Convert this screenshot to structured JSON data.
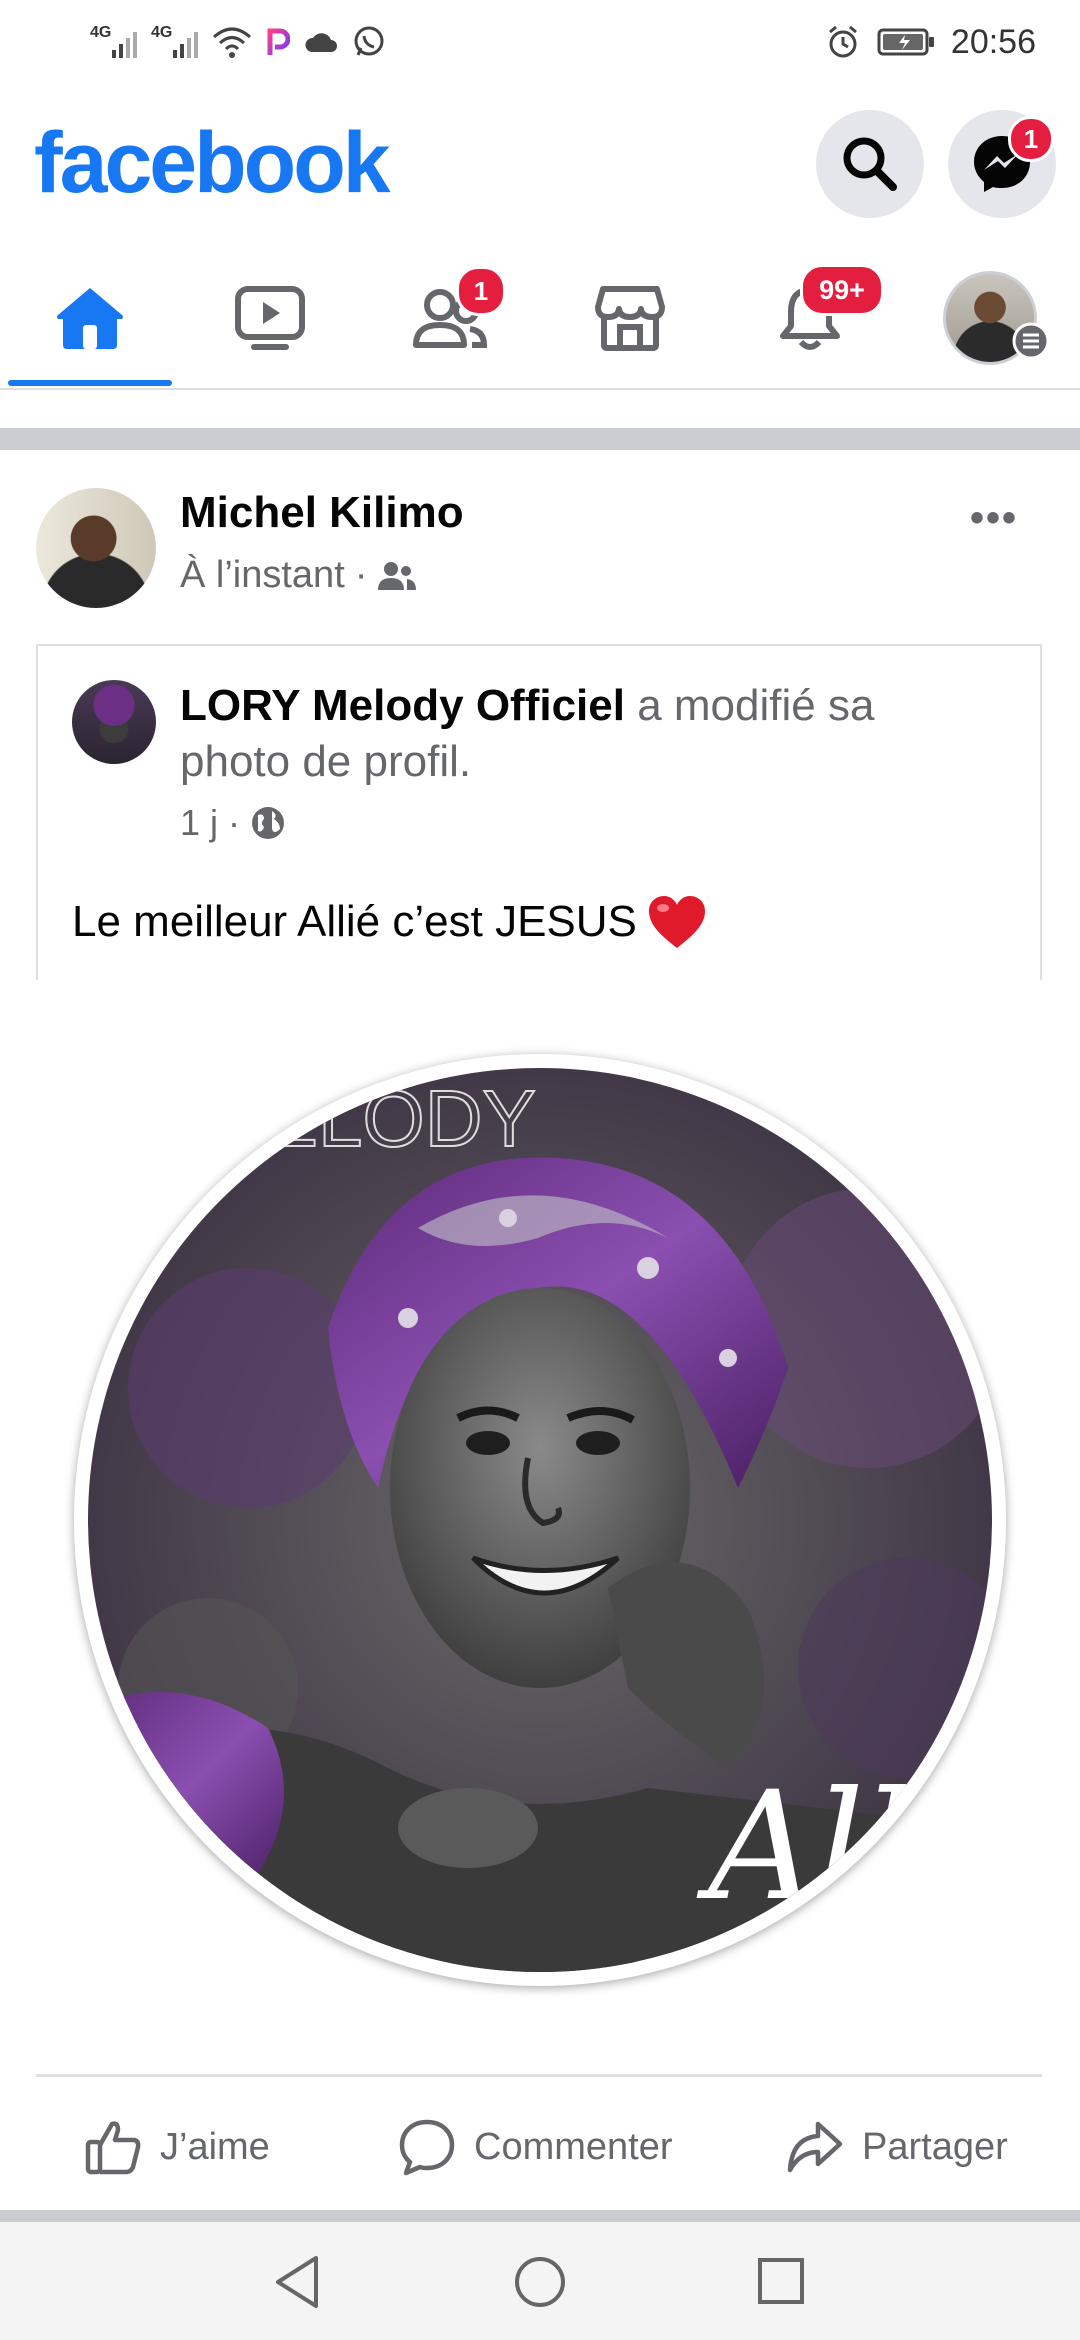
{
  "status_bar": {
    "network_1": "4G",
    "network_2": "4G",
    "time": "20:56"
  },
  "header": {
    "logo": "facebook",
    "messenger_badge": "1",
    "icons": [
      "search-icon",
      "messenger-icon"
    ]
  },
  "tabs": [
    {
      "name": "home",
      "icon": "home-icon",
      "active": true
    },
    {
      "name": "watch",
      "icon": "video-icon"
    },
    {
      "name": "friends",
      "icon": "friends-icon",
      "badge": "1"
    },
    {
      "name": "marketplace",
      "icon": "store-icon"
    },
    {
      "name": "notifications",
      "icon": "bell-icon",
      "badge": "99+"
    },
    {
      "name": "menu",
      "icon": "profile-menu-icon"
    }
  ],
  "post": {
    "author": "Michel Kilimo",
    "time": "À l’instant",
    "time_separator": "·",
    "audience_icon": "friends-audience-icon",
    "more": "•••",
    "shared": {
      "page": "LORY Melody Officiel",
      "action": " a modifié sa photo de profil.",
      "time": "1 j",
      "time_separator": "·",
      "audience_icon": "globe-icon",
      "text": "Le meilleur Allié c’est JESUS",
      "photo_watermark": "MELODY",
      "photo_signature": "All"
    },
    "actions": {
      "like": "J’aime",
      "comment": "Commenter",
      "share": "Partager"
    }
  },
  "colors": {
    "brand": "#1877f2",
    "badge": "#e41e3f",
    "secondary_text": "#65676b"
  }
}
